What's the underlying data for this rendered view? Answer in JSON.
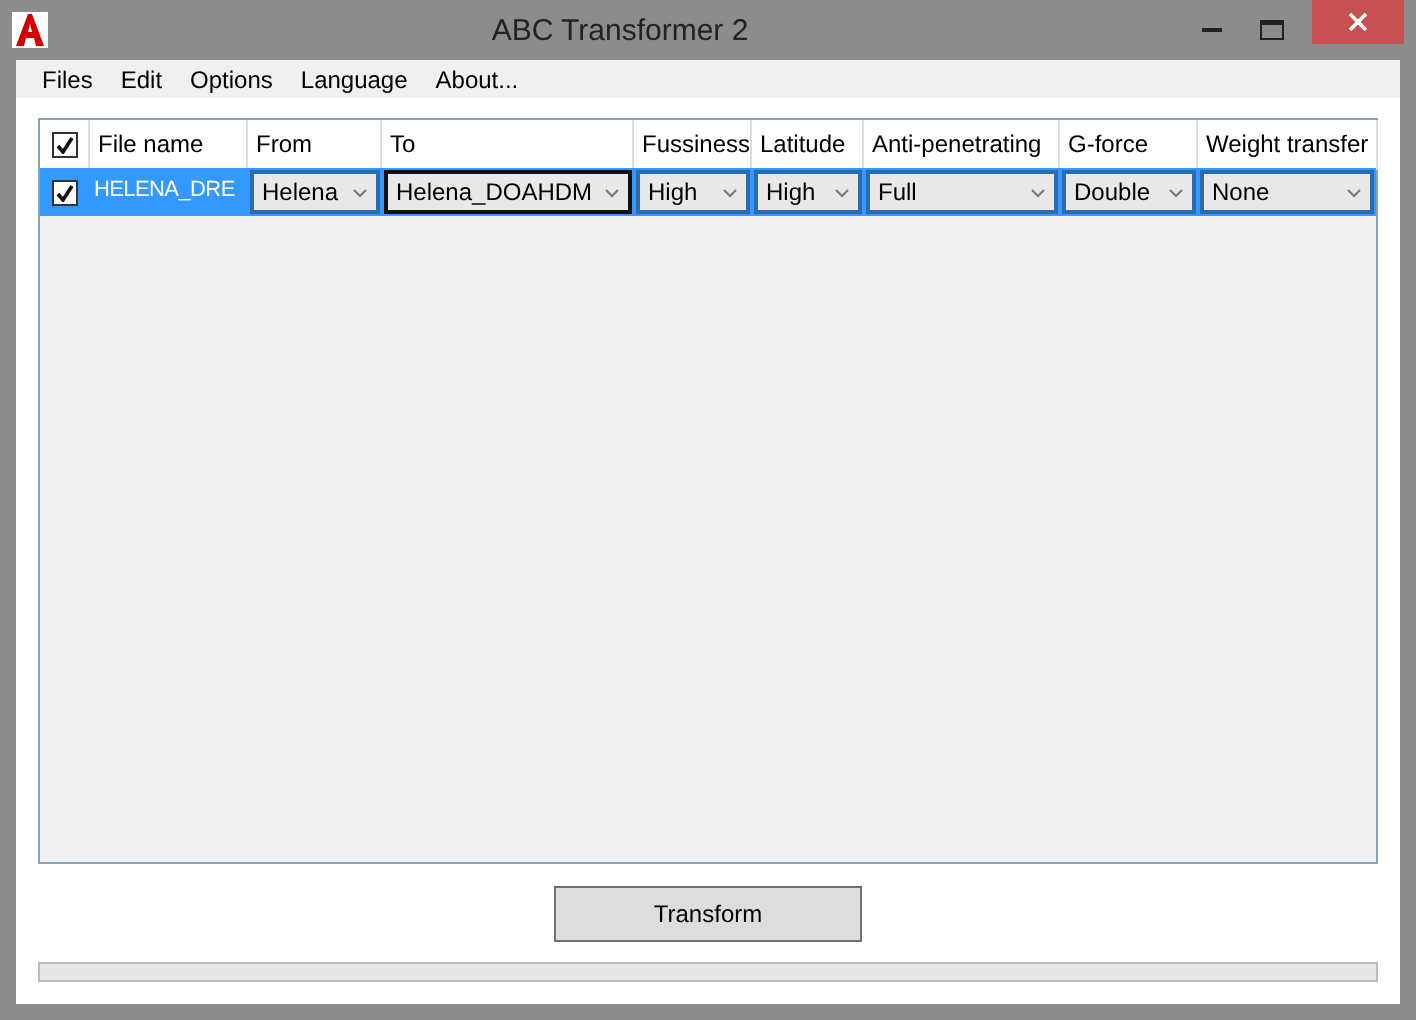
{
  "window": {
    "title": "ABC Transformer 2"
  },
  "menu": [
    "Files",
    "Edit",
    "Options",
    "Language",
    "About..."
  ],
  "table": {
    "header_checked": true,
    "columns": [
      "File name",
      "From",
      "To",
      "Fussiness",
      "Latitude",
      "Anti-penetrating",
      "G-force",
      "Weight transfer"
    ],
    "rows": [
      {
        "checked": true,
        "selected": true,
        "cells": [
          {
            "kind": "text",
            "value": "HELENA_DRE"
          },
          {
            "value": "Helena",
            "focused": false
          },
          {
            "value": "Helena_DOAHDM",
            "focused": true
          },
          {
            "value": "High",
            "focused": false
          },
          {
            "value": "High",
            "focused": false
          },
          {
            "value": "Full",
            "focused": false
          },
          {
            "value": "Double",
            "focused": false
          },
          {
            "value": "None",
            "focused": false
          }
        ]
      }
    ]
  },
  "transform_button": "Transform",
  "progress": {
    "level": 0
  }
}
